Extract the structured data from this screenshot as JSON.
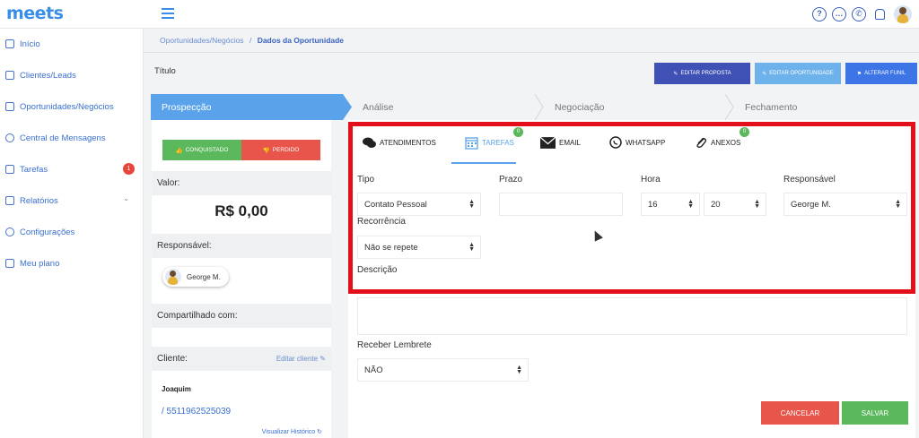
{
  "app": {
    "logo": "meets"
  },
  "sidebar": {
    "items": [
      {
        "label": "Início"
      },
      {
        "label": "Clientes/Leads"
      },
      {
        "label": "Oportunidades/Negócios"
      },
      {
        "label": "Central de Mensagens"
      },
      {
        "label": "Tarefas",
        "badge": "1"
      },
      {
        "label": "Relatórios"
      },
      {
        "label": "Configurações"
      },
      {
        "label": "Meu plano"
      }
    ]
  },
  "breadcrumb": {
    "parent": "Oportunidades/Negócios",
    "separator": "/",
    "current": "Dados da Oportunidade"
  },
  "header": {
    "title": "Título",
    "buttons": {
      "edit_proposal": "EDITAR PROPOSTA",
      "edit_opportunity": "EDITAR OPORTUNIDADE",
      "change_funnel": "ALTERAR FUNIL"
    }
  },
  "pipeline": {
    "stages": [
      "Prospecção",
      "Análise",
      "Negociação",
      "Fechamento"
    ],
    "active_index": 0
  },
  "left_panel": {
    "won_button": "CONQUISTADO",
    "lost_button": "PERDIDO",
    "value_label": "Valor:",
    "value_amount": "R$ 0,00",
    "responsible_label": "Responsável:",
    "responsible_name": "George M.",
    "shared_label": "Compartilhado com:",
    "client_label": "Cliente:",
    "edit_client": "Editar cliente",
    "client_name": "Joaquim",
    "client_phone": "/ 5511962525039",
    "view_history": "Visualizar Histórico"
  },
  "tabs": [
    {
      "label": "ATENDIMENTOS",
      "icon": "chat-icon"
    },
    {
      "label": "TAREFAS",
      "icon": "calendar-icon",
      "badge": "0",
      "active": true
    },
    {
      "label": "EMAIL",
      "icon": "envelope-icon"
    },
    {
      "label": "WHATSAPP",
      "icon": "whatsapp-icon"
    },
    {
      "label": "ANEXOS",
      "icon": "paperclip-icon",
      "badge": "0"
    }
  ],
  "form": {
    "tipo_label": "Tipo",
    "tipo_value": "Contato Pessoal",
    "prazo_label": "Prazo",
    "prazo_value": "",
    "hora_label": "Hora",
    "hora_hour": "16",
    "hora_minute": "20",
    "responsavel_label": "Responsável",
    "responsavel_value": "George M.",
    "recorrencia_label": "Recorrência",
    "recorrencia_value": "Não se repete",
    "descricao_label": "Descrição",
    "lembrete_label": "Receber Lembrete",
    "lembrete_value": "NÃO",
    "cancel_button": "CANCELAR",
    "save_button": "SALVAR"
  },
  "colors": {
    "accent": "#5aa3ea",
    "won": "#5cb85c",
    "lost": "#e8554a",
    "highlight": "#e3101c",
    "edit_proposal": "#3f51b5"
  }
}
